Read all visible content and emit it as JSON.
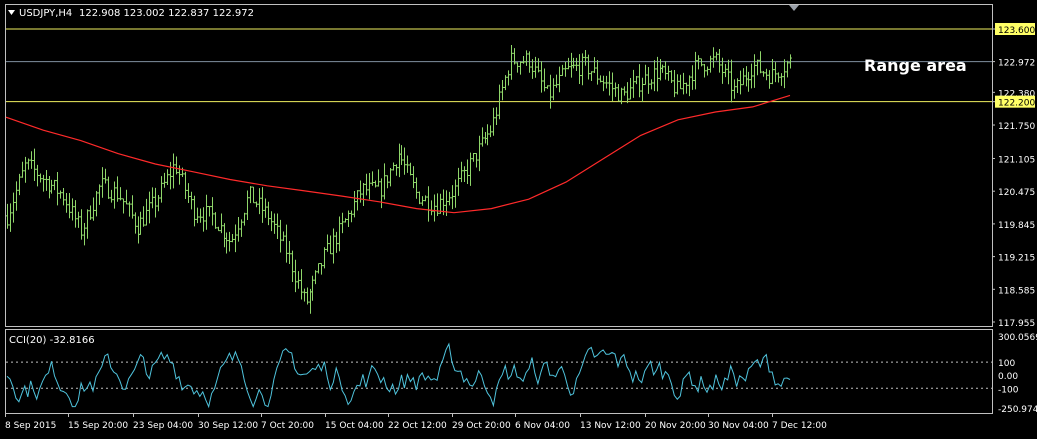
{
  "header": {
    "symbol_label": "USDJPY,H4",
    "ohlc_text": "122.908 123.002 122.837 122.972"
  },
  "annotation": {
    "range_label": "Range area"
  },
  "colors": {
    "background": "#000000",
    "border": "#c0c0c0",
    "bar": "#8fd66a",
    "moving_average": "#ff2a2a",
    "level_line": "#f0f060",
    "price_marker_bg": "#ffff66",
    "current_price_line": "#8090a0",
    "cci_line": "#4fc3dc",
    "cci_level": "#c0c0c0",
    "text": "#ffffff"
  },
  "chart_data": [
    {
      "type": "ohlc",
      "title": "USDJPY,H4",
      "ylim": [
        117.955,
        123.6
      ],
      "price_axis_ticks": [
        123.6,
        122.972,
        122.38,
        122.2,
        121.75,
        121.105,
        120.475,
        119.845,
        119.215,
        118.585,
        117.955
      ],
      "price_axis_labels": [
        "123.600",
        "122.972",
        "122.380",
        "122.200",
        "121.750",
        "121.105",
        "120.475",
        "119.845",
        "119.215",
        "118.585",
        "117.955"
      ],
      "x_tick_labels": [
        "8 Sep 2015",
        "15 Sep 20:00",
        "23 Sep 04:00",
        "30 Sep 12:00",
        "7 Oct 20:00",
        "15 Oct 04:00",
        "22 Oct 12:00",
        "29 Oct 20:00",
        "6 Nov 04:00",
        "13 Nov 12:00",
        "20 Nov 20:00",
        "30 Nov 04:00",
        "7 Dec 12:00"
      ],
      "horizontal_levels": [
        {
          "value": 123.6,
          "label": "123.600"
        },
        {
          "value": 122.2,
          "label": "122.200"
        }
      ],
      "current_price": 122.972,
      "moving_average": [
        121.9,
        121.65,
        121.45,
        121.2,
        121.0,
        120.85,
        120.7,
        120.58,
        120.48,
        120.38,
        120.27,
        120.14,
        120.06,
        120.14,
        120.32,
        120.65,
        121.1,
        121.55,
        121.85,
        122.0,
        122.1,
        122.32
      ],
      "close_path": [
        120.0,
        121.0,
        120.7,
        120.4,
        119.7,
        120.6,
        120.4,
        119.8,
        120.3,
        121.0,
        120.1,
        120.0,
        119.5,
        120.4,
        120.0,
        119.3,
        118.3,
        119.2,
        119.8,
        120.5,
        120.5,
        121.2,
        120.4,
        120.2,
        120.5,
        121.1,
        121.7,
        123.0,
        123.0,
        122.3,
        122.8,
        122.9,
        122.6,
        122.3,
        122.6,
        122.8,
        122.4,
        122.9,
        123.0,
        122.4,
        122.9,
        122.7,
        122.97
      ],
      "bars_count": 265
    },
    {
      "type": "line",
      "title": "CCI(20) -32.8166",
      "ylim": [
        -250.9741,
        300.0569
      ],
      "axis_labels": [
        "300.0569",
        "100",
        "0.00",
        "-100",
        "-250.9741"
      ],
      "levels": [
        100,
        -100
      ],
      "last_value": -32.8166
    }
  ]
}
